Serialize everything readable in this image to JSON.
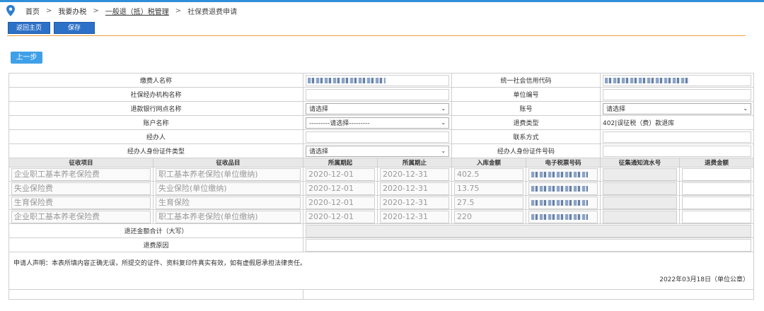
{
  "breadcrumb": [
    "首页",
    "我要办税",
    "一般退（抵）税管理",
    "社保费退费申请"
  ],
  "breadcrumb_sep": ">",
  "toolbar": {
    "home": "返回主页",
    "save": "保存"
  },
  "prev_step": "上一步",
  "form": {
    "payer_name_label": "缴费人名称",
    "credit_code_label": "统一社会信用代码",
    "agency_label": "社保经办机构名称",
    "unit_no_label": "单位编号",
    "bank_label": "退款银行网点名称",
    "bank_value": "请选择",
    "account_label": "账号",
    "account_value": "请选择",
    "account_name_label": "账户名称",
    "account_name_value": "---------请选择---------",
    "refund_type_label": "退费类型",
    "refund_type_value": "402|误征税（费）款退库",
    "agent_label": "经办人",
    "contact_label": "联系方式",
    "id_type_label": "经办人身份证件类型",
    "id_type_value": "请选择",
    "id_no_label": "经办人身份证件号码"
  },
  "columns": [
    "征收项目",
    "征收品目",
    "所属期起",
    "所属期止",
    "入库金额",
    "电子税票号码",
    "征集通知流水号",
    "退费金额"
  ],
  "rows": [
    {
      "item": "企业职工基本养老保险费",
      "sub": "职工基本养老保险(单位缴纳)",
      "start": "2020-12-01",
      "end": "2020-12-31",
      "amount": "402.5"
    },
    {
      "item": "失业保险费",
      "sub": "失业保险(单位缴纳)",
      "start": "2020-12-01",
      "end": "2020-12-31",
      "amount": "13.75"
    },
    {
      "item": "生育保险费",
      "sub": "生育保险",
      "start": "2020-12-01",
      "end": "2020-12-31",
      "amount": "27.5"
    },
    {
      "item": "企业职工基本养老保险费",
      "sub": "职工基本养老保险(单位缴纳)",
      "start": "2020-12-01",
      "end": "2020-12-31",
      "amount": "220"
    }
  ],
  "total_label": "退还金额合计（大写）",
  "reason_label": "退费原因",
  "declaration": "申请人声明：本表所填内容正确无误，所提交的证件、资料复印件真实有效，如有虚假愿承担法律责任。",
  "decl_date": "2022年03月18日（单位公章）",
  "colors": {
    "accent": "#2d70c7",
    "divider": "#f0a040",
    "prev": "#3fa0e8"
  },
  "icons": {
    "breadcrumb": "location-pin-icon"
  }
}
